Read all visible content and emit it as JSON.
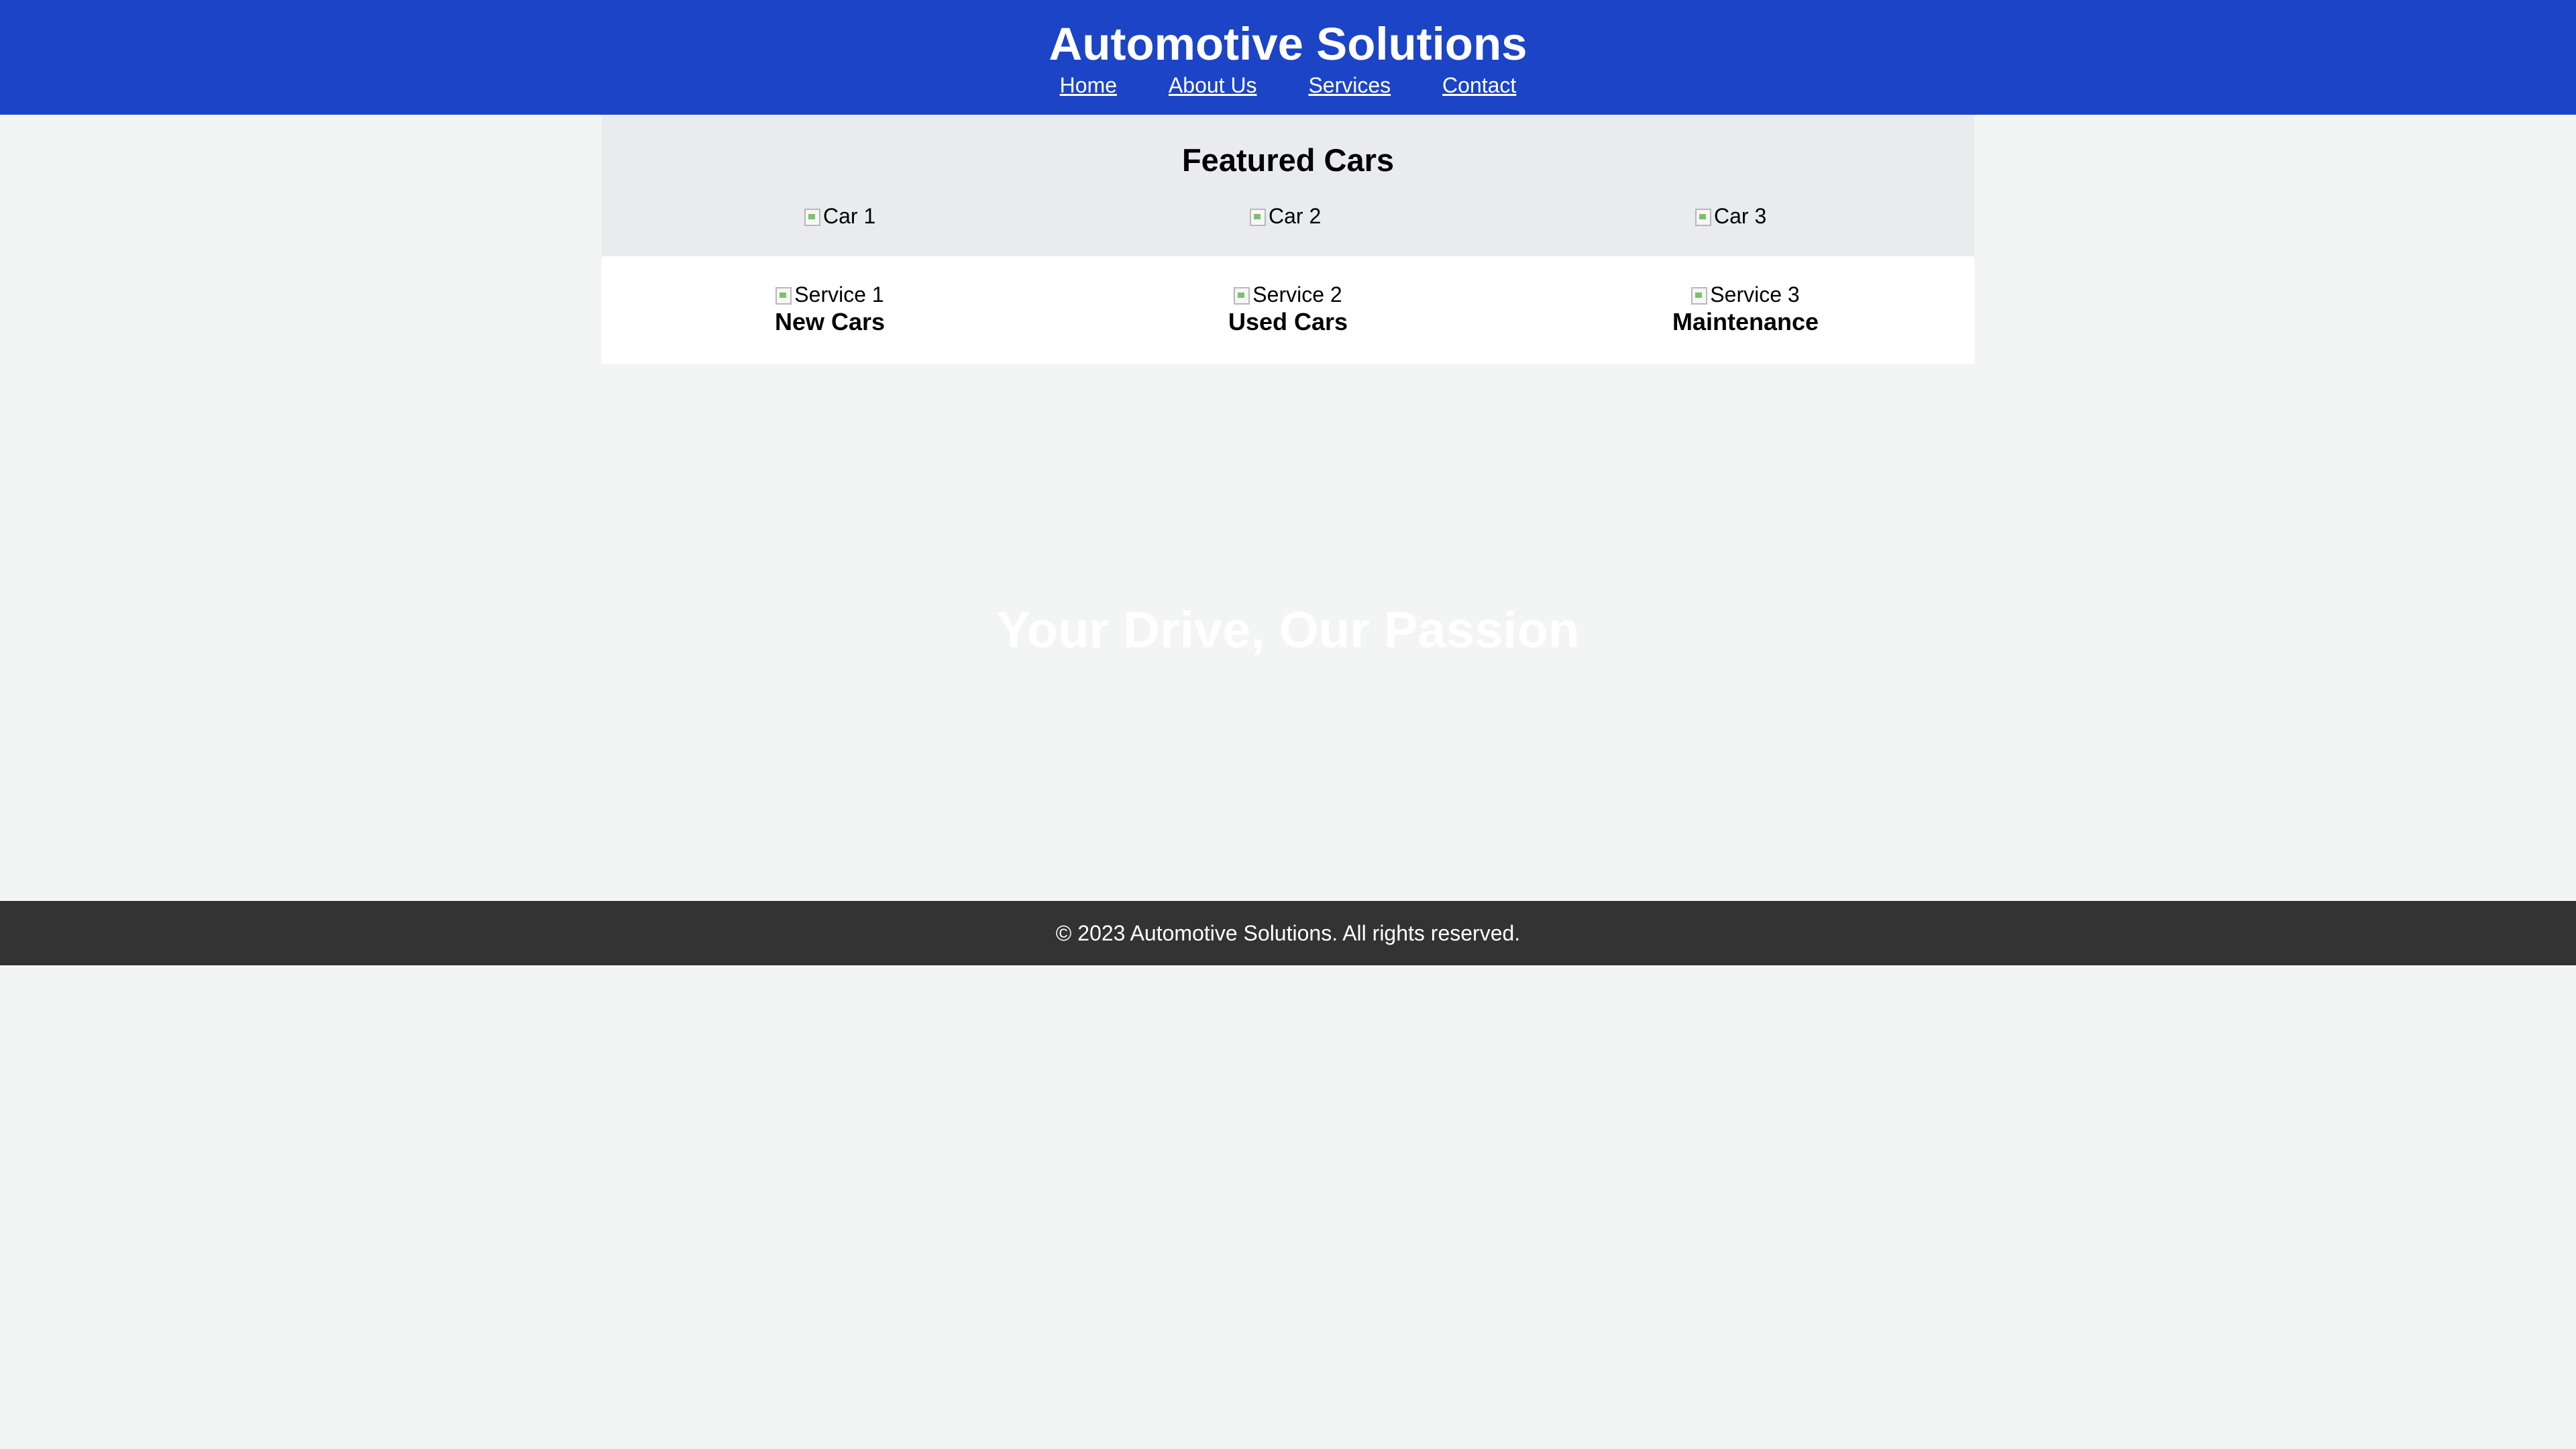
{
  "header": {
    "title": "Automotive Solutions",
    "nav": [
      {
        "label": "Home"
      },
      {
        "label": "About Us"
      },
      {
        "label": "Services"
      },
      {
        "label": "Contact"
      }
    ]
  },
  "featured": {
    "title": "Featured Cars",
    "cars": [
      {
        "alt": "Car 1"
      },
      {
        "alt": "Car 2"
      },
      {
        "alt": "Car 3"
      }
    ]
  },
  "services": [
    {
      "alt": "Service 1",
      "label": "New Cars"
    },
    {
      "alt": "Service 2",
      "label": "Used Cars"
    },
    {
      "alt": "Service 3",
      "label": "Maintenance"
    }
  ],
  "hero": {
    "title": "Your Drive, Our Passion"
  },
  "footer": {
    "text": "© 2023 Automotive Solutions. All rights reserved."
  },
  "colors": {
    "header_bg": "#1c44c6",
    "page_bg": "#f3f4f4",
    "featured_bg": "#e9ebee",
    "services_bg": "#ffffff",
    "footer_bg": "#333333"
  }
}
